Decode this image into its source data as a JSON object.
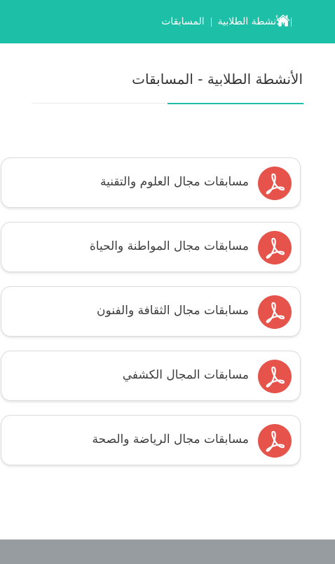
{
  "header": {
    "background": "#1dbfa6",
    "home_icon": "home-icon",
    "breadcrumb": {
      "parent": "الأنشطة الطلابية",
      "current": "المسابقات"
    }
  },
  "page": {
    "title": "الأنشطة الطلابية - المسابقات",
    "accent_color": "#1dbfa6"
  },
  "documents": {
    "icon": "pdf-icon",
    "icon_color": "#e5534b",
    "items": [
      {
        "label": "مسابقات مجال العلوم والتقنية"
      },
      {
        "label": "مسابقات مجال المواطنة والحياة"
      },
      {
        "label": "مسابقات مجال الثقافة والفنون"
      },
      {
        "label": "مسابقات المجال الكشفي"
      },
      {
        "label": "مسابقات مجال الرياضة والصحة"
      }
    ]
  },
  "footer": {
    "background": "#979ca1"
  }
}
